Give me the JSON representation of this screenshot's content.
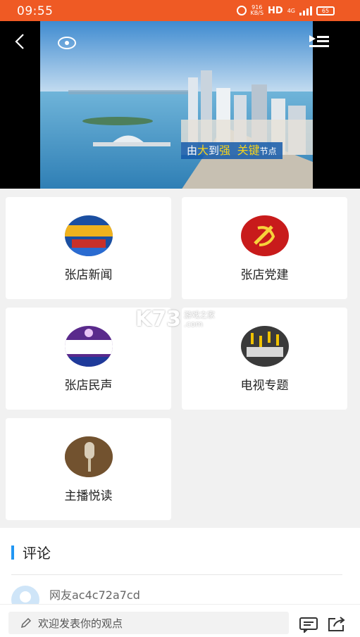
{
  "status_bar": {
    "time": "09:55",
    "speed_value": "916",
    "speed_unit": "KB/S",
    "network": "HD",
    "signal_label": "4G",
    "battery": "65",
    "background": "#ef5a24"
  },
  "video": {
    "caption_parts": [
      "由",
      "大",
      "到",
      "强",
      "关键",
      "节点"
    ],
    "back_icon": "chevron-left-icon",
    "menu_icon": "playlist-icon"
  },
  "grid": {
    "items": [
      {
        "label": "张店新闻",
        "icon": "news-thumbnail"
      },
      {
        "label": "张店党建",
        "icon": "party-emblem-thumbnail"
      },
      {
        "label": "张店民声",
        "icon": "voice-thumbnail"
      },
      {
        "label": "电视专题",
        "icon": "mixing-console-thumbnail"
      },
      {
        "label": "主播悦读",
        "icon": "microphone-thumbnail"
      }
    ]
  },
  "watermark": {
    "brand": "K73",
    "line1": "游戏之家",
    "line2": ".com"
  },
  "comments": {
    "title": "评论",
    "accent": "#2196f3",
    "items": [
      {
        "user": "网友ac4c72a7cd"
      }
    ]
  },
  "bottom_bar": {
    "placeholder": "欢迎发表你的观点"
  }
}
